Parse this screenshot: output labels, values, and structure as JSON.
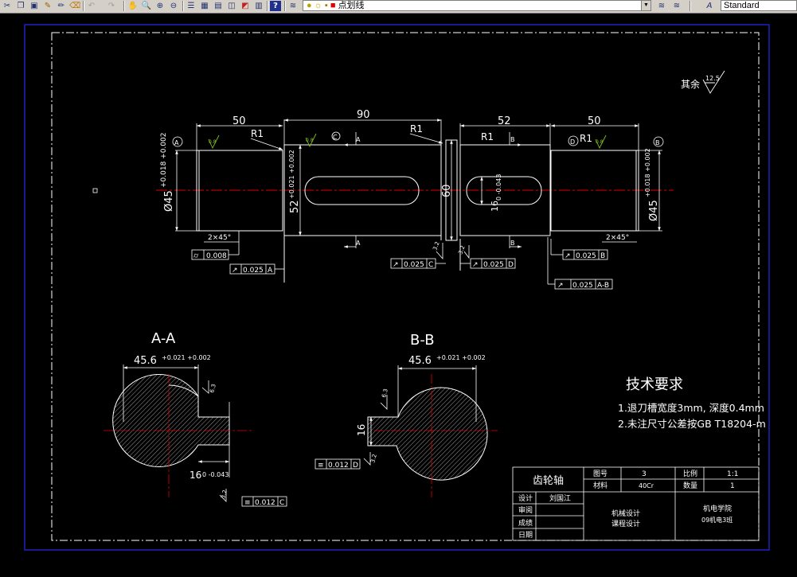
{
  "toolbar": {
    "layer_combo": {
      "value": "点划线"
    },
    "text_style_combo": {
      "value": "Standard"
    },
    "icons": [
      "cut-icon",
      "copy-icon",
      "paste-icon",
      "match-properties-icon",
      "pencil-icon",
      "eraser-icon",
      "undo-icon",
      "redo-icon",
      "pan-icon",
      "zoom-realtime-icon",
      "zoom-window-icon",
      "zoom-previous-icon",
      "properties-icon",
      "design-center-icon",
      "tool-palettes-icon",
      "sheet-set-icon",
      "markup-icon",
      "calculator-icon",
      "help-icon",
      "layer-manager-icon",
      "layer-state-icon",
      "layer-previous-icon",
      "text-style-icon"
    ]
  },
  "drawing": {
    "roughness_note": {
      "label": "其余",
      "value": "12.5"
    },
    "dims": {
      "d50_left": "50",
      "d90": "90",
      "d52": "52",
      "d50_right": "50",
      "r1_a": "R1",
      "r1_b": "R1",
      "r1_c": "R1",
      "r1_d": "R1",
      "dia45_left": "Ø45",
      "dia45_left_tol": "+0.018 +0.002",
      "dia52": "52",
      "dia52_tol": "+0.021 +0.002",
      "d60": "60",
      "d16_top": "16",
      "d16_top_tol": "0 -0.043",
      "dia45_right": "Ø45",
      "dia45_right_tol": "+0.018 +0.002",
      "chamfer_left": "2×45°",
      "chamfer_right": "2×45°",
      "datum_a": "A",
      "datum_b": "B",
      "datum_c": "C",
      "datum_d": "D",
      "rough_08_a": "0.8",
      "rough_08_b": "0.8",
      "rough_08_c": "0.8",
      "rough_32": "3.2",
      "rough_32_b": "3.2"
    },
    "tolerance_frames": {
      "cyl_left": {
        "symbol": "⌭",
        "value": "0.008"
      },
      "runout_a": {
        "symbol": "↗",
        "value": "0.025",
        "datum": "A"
      },
      "runout_c": {
        "symbol": "↗",
        "value": "0.025",
        "datum": "C"
      },
      "runout_d": {
        "symbol": "↗",
        "value": "0.025",
        "datum": "D"
      },
      "runout_b": {
        "symbol": "↗",
        "value": "0.025",
        "datum": "B"
      },
      "runout_ab": {
        "symbol": "↗",
        "value": "0.025",
        "datum": "A-B"
      },
      "sym_bb": {
        "symbol": "≡",
        "value": "0.012",
        "datum": "D"
      },
      "sym_aa": {
        "symbol": "≡",
        "value": "0.012",
        "datum": "C"
      }
    },
    "section_aa": {
      "title": "A-A",
      "width": "45.6",
      "width_tol": "+0.021 +0.002",
      "key": "16",
      "key_tol": "0 -0.043",
      "rough": "6.3",
      "rough2": "3.2"
    },
    "section_bb": {
      "title": "B-B",
      "width": "45.6",
      "width_tol": "+0.021 +0.002",
      "key": "16",
      "rough": "6.3",
      "rough2": "3.2"
    },
    "tech_req": {
      "title": "技术要求",
      "line1": "1.退刀槽宽度3mm, 深度0.4mm",
      "line2": "2.未注尺寸公差按GB T18204-m"
    },
    "title_block": {
      "part_name": "齿轮轴",
      "drawing_no_label": "图号",
      "drawing_no": "3",
      "scale_label": "比例",
      "scale": "1:1",
      "material_label": "材料",
      "material": "40Cr",
      "qty_label": "数量",
      "qty": "1",
      "design_label": "设计",
      "designer": "刘国江",
      "review_label": "审阅",
      "grade_label": "成绩",
      "date_label": "日期",
      "course1": "机械设计",
      "course2": "课程设计",
      "school1": "机电学院",
      "school2": "09机电3班"
    }
  },
  "colors": {
    "background": "#000000",
    "outline": "#ffffff",
    "centerline": "#e00000",
    "hatch": "#ffffff",
    "viewport": "#2020c0",
    "roughness": "#80c020",
    "frame": "#ffffff"
  }
}
